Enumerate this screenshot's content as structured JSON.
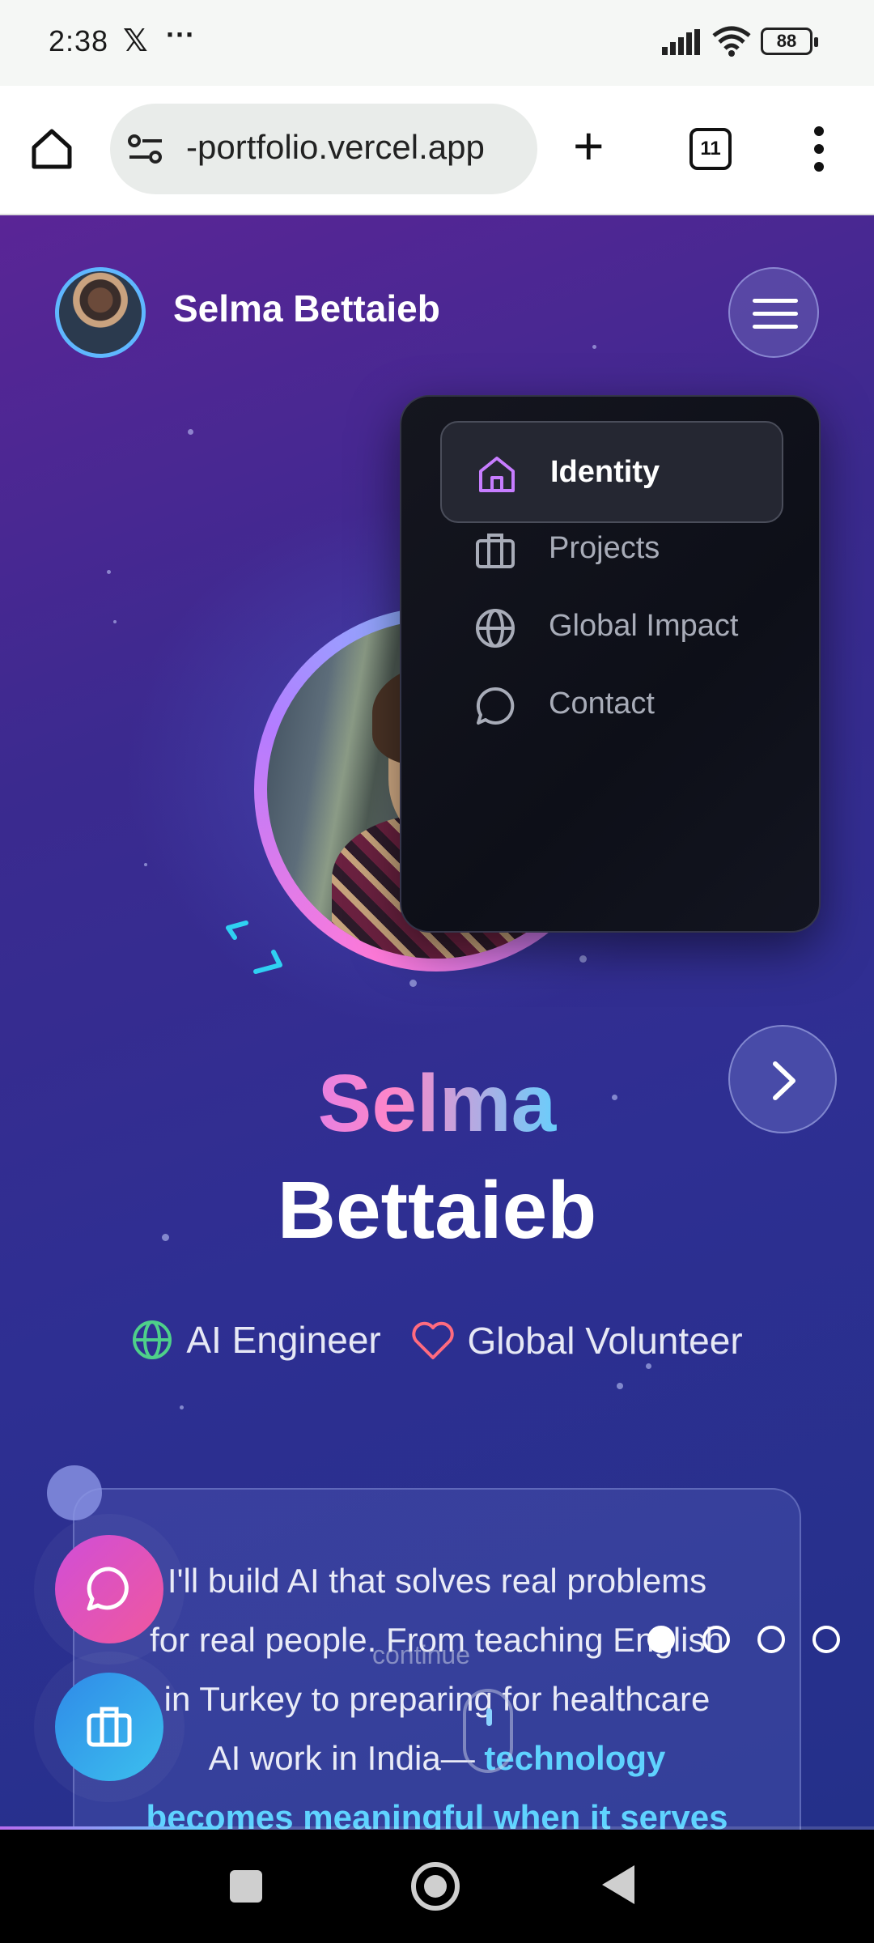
{
  "status_bar": {
    "time": "2:38",
    "x_logo": "𝕏",
    "more": "···",
    "battery": "88"
  },
  "browser": {
    "url": "-portfolio.vercel.app",
    "tab_count": "11"
  },
  "nav": {
    "name": "Selma Bettaieb"
  },
  "menu": {
    "items": [
      {
        "label": "Identity",
        "icon": "home-icon",
        "active": true
      },
      {
        "label": "Projects",
        "icon": "briefcase-icon",
        "active": false
      },
      {
        "label": "Global Impact",
        "icon": "globe-icon",
        "active": false
      },
      {
        "label": "Contact",
        "icon": "chat-bubble-icon",
        "active": false
      }
    ]
  },
  "hero": {
    "first_name": "Selma",
    "last_name": "Bettaieb"
  },
  "roles": [
    {
      "label": "AI Engineer",
      "icon": "globe-icon",
      "color": "#4ed08a"
    },
    {
      "label": "Global Volunteer",
      "icon": "heart-icon",
      "color": "#ff6b7f"
    }
  ],
  "quote": {
    "lines": [
      "I'll build AI that solves real problems",
      "for real people. From teaching English",
      "in Turkey to preparing for healthcare",
      "AI work in India—"
    ],
    "highlight_1": "technology",
    "highlight_2": "becomes meaningful when it serves"
  },
  "scroll": {
    "continue_label": "continue"
  },
  "slides": {
    "count": 4,
    "active_index": 0
  },
  "progress": {
    "fraction": 0.25
  },
  "colors": {
    "accent_cyan": "#5fd3ff",
    "accent_pink": "#ff86c8",
    "accent_purple": "#b86cf0"
  }
}
